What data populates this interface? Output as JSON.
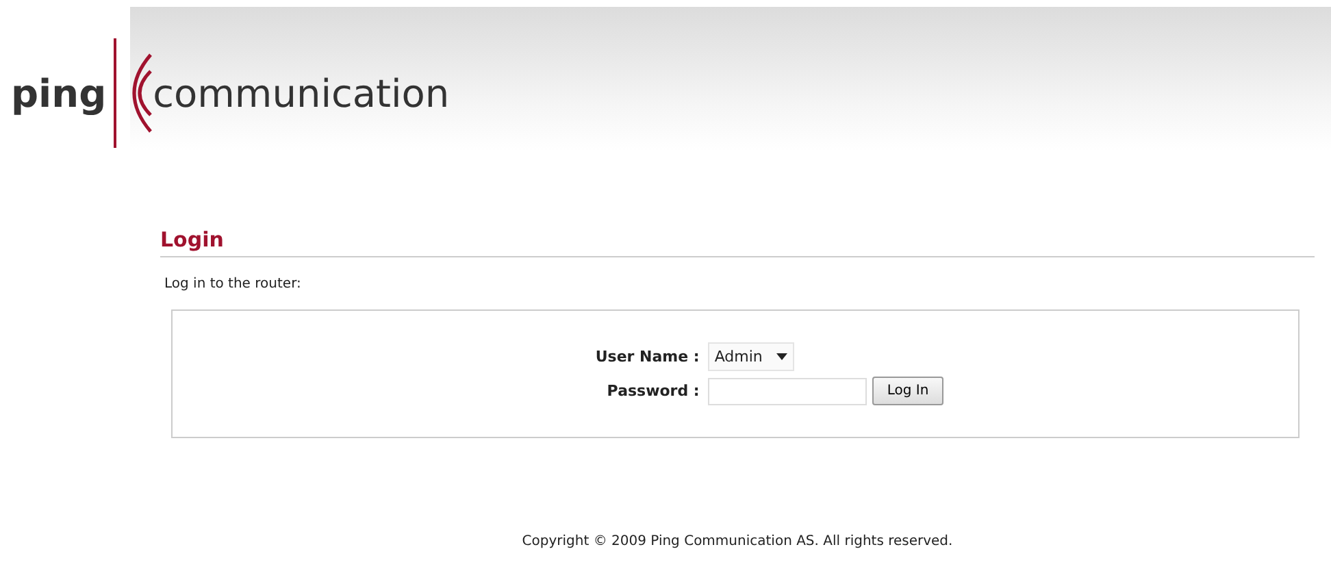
{
  "logo": {
    "word_1": "ping",
    "word_2": "communication"
  },
  "section": {
    "title": "Login",
    "intro": "Log in to the router:"
  },
  "form": {
    "user_name": {
      "label": "User Name :",
      "value": "Admin"
    },
    "password": {
      "label": "Password :"
    },
    "submit": "Log In"
  },
  "footer": {
    "copyright": "Copyright © 2009 Ping Communication AS. All rights reserved."
  }
}
